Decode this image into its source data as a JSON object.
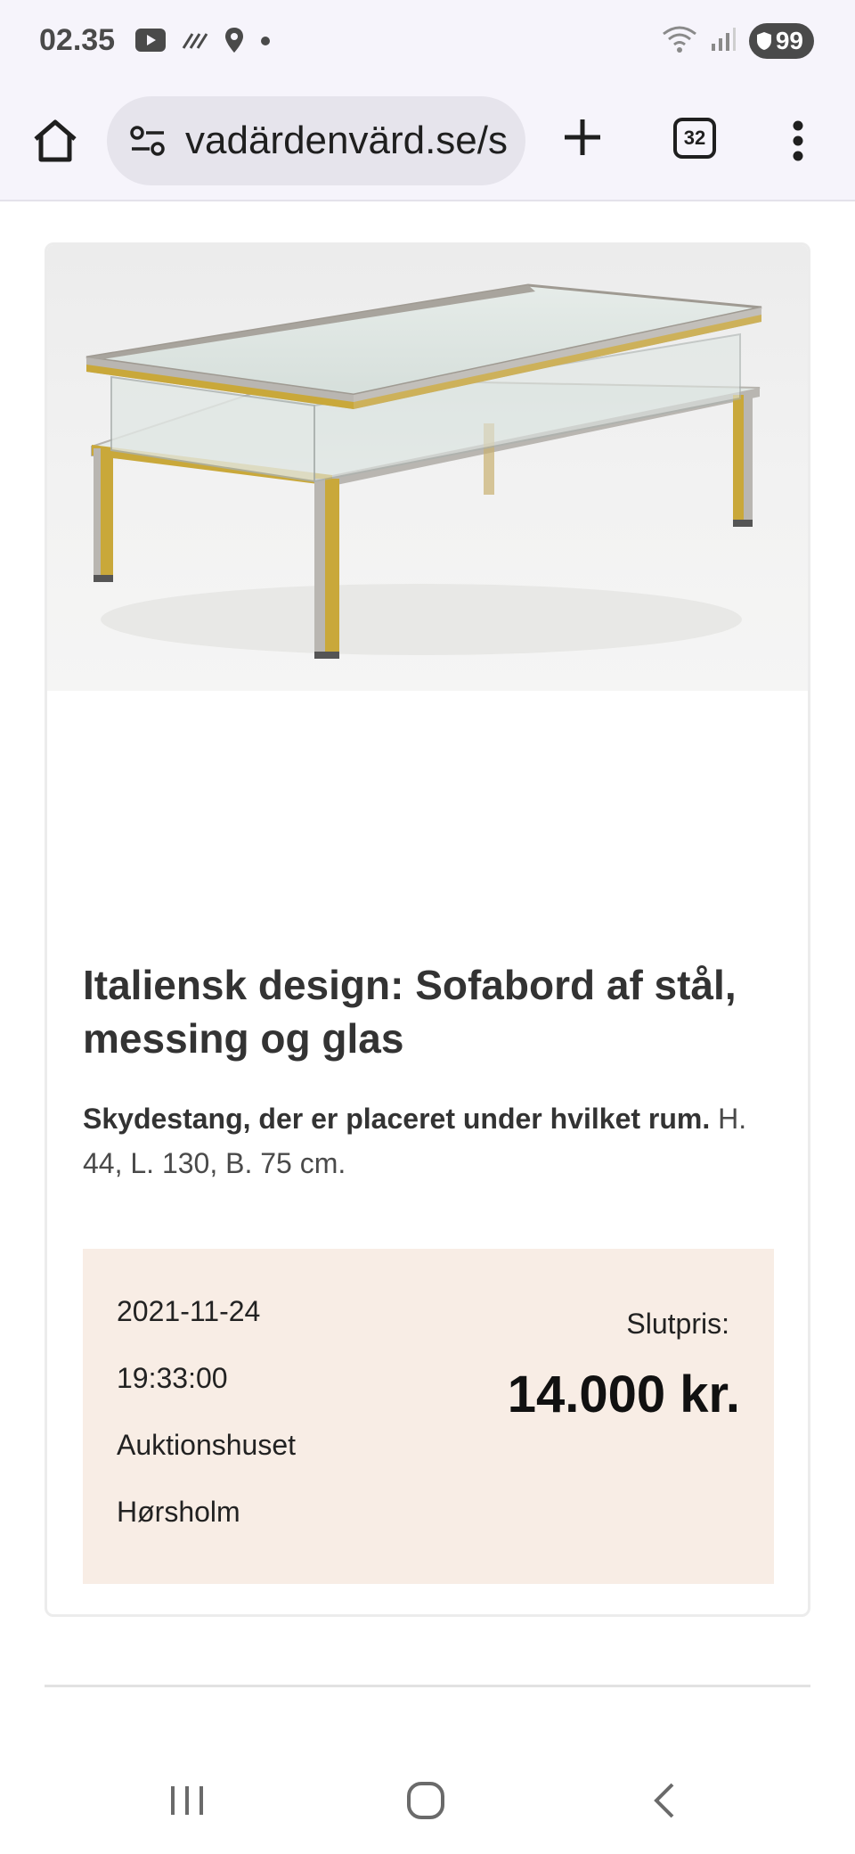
{
  "status_bar": {
    "time": "02.35",
    "icons": [
      "youtube-icon",
      "signal-stripes-icon",
      "location-pin-icon",
      "dot-icon",
      "wifi-icon",
      "cell-signal-icon"
    ],
    "battery": "99"
  },
  "browser": {
    "url": "vadärdenvärd.se/s",
    "tab_count": "32",
    "icons": [
      "home-icon",
      "site-settings-icon",
      "plus-icon",
      "tabs-icon",
      "more-vert-icon"
    ]
  },
  "product": {
    "title": "Italiensk design: Sofabord af stål, messing og glas",
    "description_bold": "Skydestang, der er placeret under hvilket rum.",
    "description_rest": " H. 44, L. 130, B. 75 cm.",
    "date": "2021-11-24",
    "time": "19:33:00",
    "house_line1": "Auktionshuset",
    "house_line2": "Hørsholm",
    "price_label": "Slutpris:",
    "price": "14.000 kr."
  },
  "colors": {
    "info_box_bg": "#f8ede5",
    "toolbar_bg": "#f6f4fb",
    "brass": "#c9a83a",
    "steel": "#b9b6b1"
  }
}
